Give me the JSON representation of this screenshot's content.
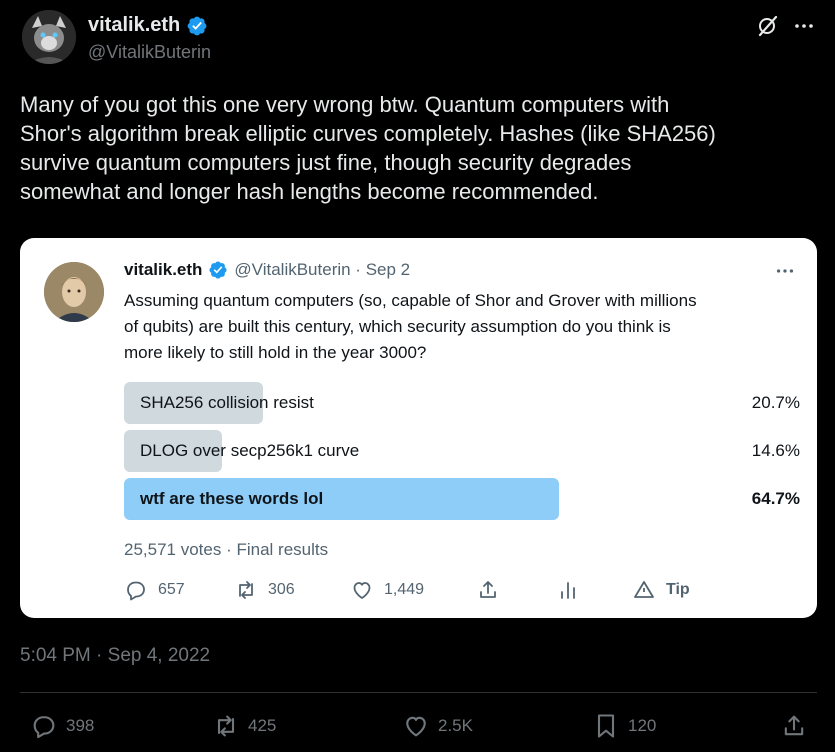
{
  "tweet": {
    "display_name": "vitalik.eth",
    "handle": "@VitalikButerin",
    "text": "Many of you got this one very wrong btw. Quantum computers with\nShor's algorithm break elliptic curves completely. Hashes (like SHA256)\nsurvive quantum computers just fine, though security degrades\nsomewhat and longer hash lengths become recommended.",
    "timestamp": "5:04 PM · Sep 4, 2022",
    "icons": {
      "verified": "verified-badge-icon",
      "grok": "grok-icon",
      "more": "more-icon"
    }
  },
  "quoted": {
    "display_name": "vitalik.eth",
    "handle_date": "@VitalikButerin · Sep 2",
    "text": "Assuming quantum computers (so, capable of Shor and Grover with millions\nof qubits) are built this century, which security assumption do you think is\nmore likely to still hold in the year 3000?",
    "poll": {
      "options": [
        {
          "label": "SHA256 collision resist",
          "percent_text": "20.7%",
          "percent": 20.7,
          "winner": false
        },
        {
          "label": "DLOG over secp256k1 curve",
          "percent_text": "14.6%",
          "percent": 14.6,
          "winner": false
        },
        {
          "label": "wtf are these words lol",
          "percent_text": "64.7%",
          "percent": 64.7,
          "winner": true
        }
      ],
      "meta": "25,571 votes · Final results"
    },
    "actions": {
      "replies": "657",
      "retweets": "306",
      "likes": "1,449",
      "tip": "Tip"
    }
  },
  "actions": {
    "replies": "398",
    "retweets": "425",
    "likes": "2.5K",
    "bookmarks": "120"
  },
  "colors": {
    "background": "#000000",
    "verified": "#1d9bf0",
    "poll_winner": "#8ecdf8",
    "poll_other": "#cfd9de",
    "muted": "#71767b"
  }
}
